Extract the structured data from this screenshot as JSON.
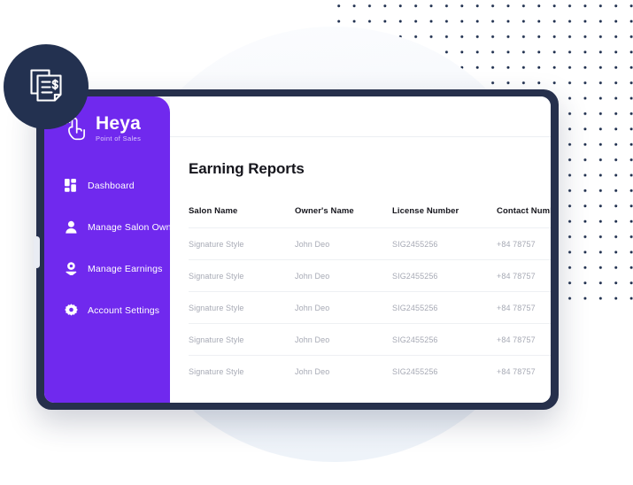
{
  "brand": {
    "title": "Heya",
    "subtitle": "Point of Sales",
    "logo_icon": "tap-hand-icon",
    "badge_icon": "invoice-document-dollar-icon",
    "accent_color": "#7029ee",
    "dark_color": "#233150"
  },
  "sidebar": {
    "items": [
      {
        "label": "Dashboard",
        "icon": "grid-dashboard-icon",
        "active": false,
        "chevron": false
      },
      {
        "label": "Manage Salon Owner",
        "icon": "user-icon",
        "active": false,
        "chevron": false
      },
      {
        "label": "Manage Earnings",
        "icon": "user-earnings-icon",
        "active": true,
        "chevron": false
      },
      {
        "label": "Account Settings",
        "icon": "gear-icon",
        "active": false,
        "chevron": true
      }
    ]
  },
  "main": {
    "page_title": "Earning Reports",
    "table": {
      "columns": [
        "Salon Name",
        "Owner's Name",
        "License Number",
        "Contact Number"
      ],
      "rows": [
        [
          "Signature Style",
          "John Deo",
          "SIG2455256",
          "+84 78757"
        ],
        [
          "Signature Style",
          "John Deo",
          "SIG2455256",
          "+84 78757"
        ],
        [
          "Signature Style",
          "John Deo",
          "SIG2455256",
          "+84 78757"
        ],
        [
          "Signature Style",
          "John Deo",
          "SIG2455256",
          "+84 78757"
        ],
        [
          "Signature Style",
          "John Deo",
          "SIG2455256",
          "+84 78757"
        ]
      ]
    }
  },
  "decor": {
    "dot_pattern_color": "#20304f",
    "circle_color": "#f1f5fa",
    "bezel_color": "#26304c"
  }
}
